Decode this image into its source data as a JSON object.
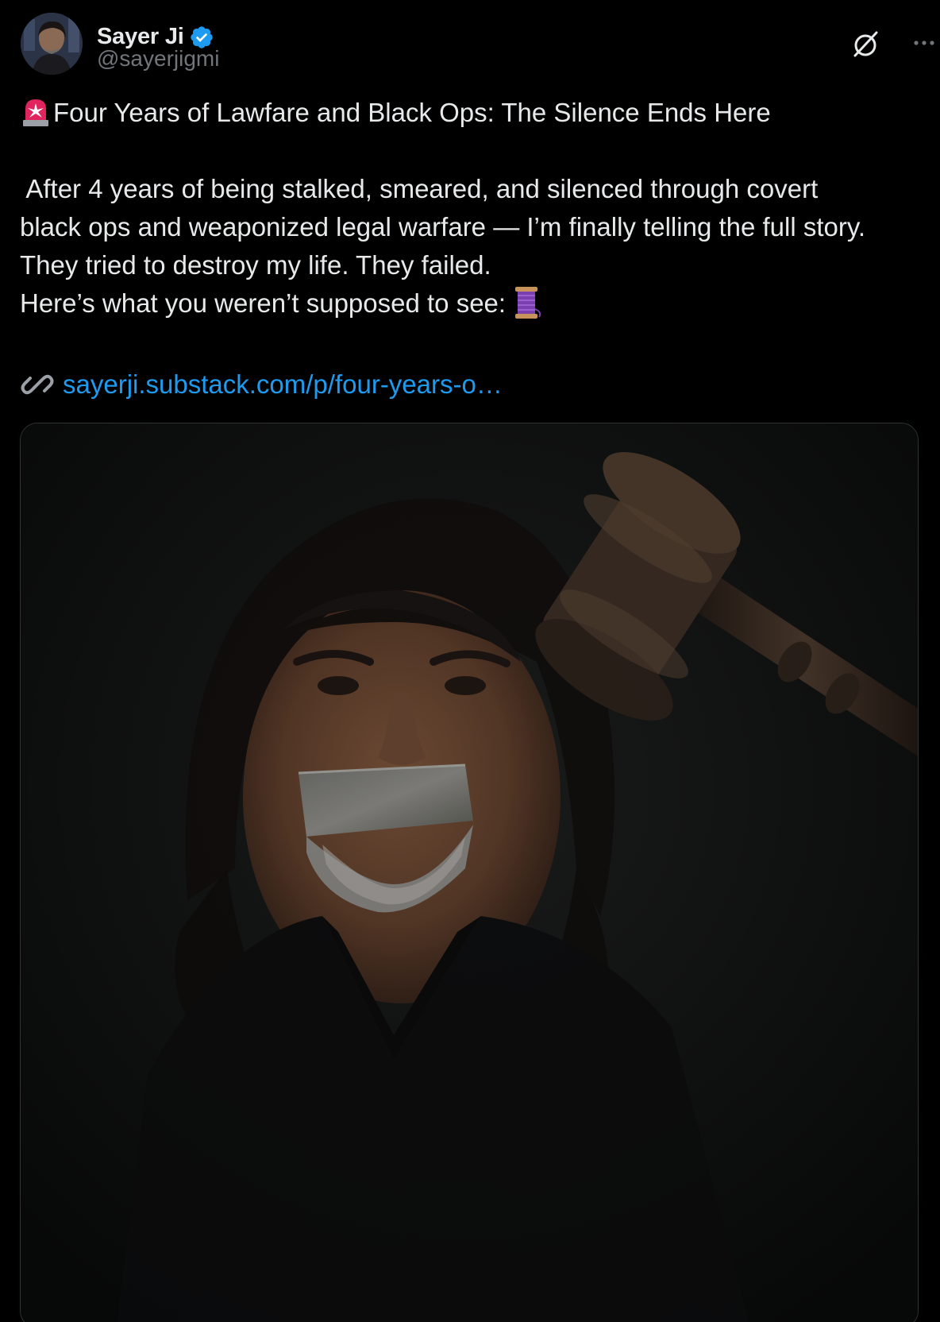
{
  "author": {
    "display_name": "Sayer Ji",
    "handle": "@sayerjigmi",
    "verified": true
  },
  "post": {
    "title_line": "Four Years of Lawfare and Black Ops: The Silence Ends Here",
    "body_lines": [
      " After 4 years of being stalked, smeared, and silenced through covert",
      "black ops and weaponized legal warfare — I’m finally telling the full story.",
      "They tried to destroy my life. They failed.",
      "Here’s what you weren’t supposed to see:"
    ],
    "link_text": "sayerji.substack.com/p/four-years-o…"
  },
  "icons": {
    "siren": "police-siren-emoji",
    "spool": "thread-spool-emoji",
    "link": "link-chain-emoji",
    "grok": "grok-icon",
    "more": "more-options-icon",
    "verified": "verified-badge-icon"
  },
  "colors": {
    "background": "#000000",
    "text": "#e7e9ea",
    "secondary_text": "#71767b",
    "link": "#1d9bf0",
    "verified": "#1d9bf0"
  }
}
